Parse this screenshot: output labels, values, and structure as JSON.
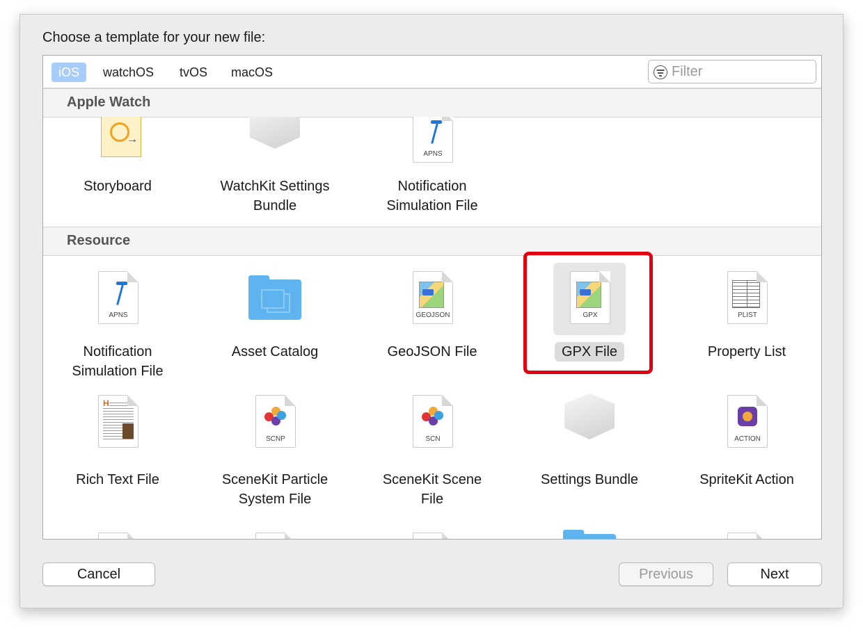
{
  "dialog": {
    "title": "Choose a template for your new file:"
  },
  "platform_tabs": [
    {
      "label": "iOS",
      "active": true
    },
    {
      "label": "watchOS",
      "active": false
    },
    {
      "label": "tvOS",
      "active": false
    },
    {
      "label": "macOS",
      "active": false
    }
  ],
  "filter": {
    "placeholder": "Filter",
    "icon": "filter-icon"
  },
  "sections": [
    {
      "title": "Apple Watch",
      "items": [
        {
          "label": "Storyboard",
          "icon": "storyboard-icon"
        },
        {
          "label": "WatchKit Settings Bundle",
          "icon": "settings-bundle-icon"
        },
        {
          "label": "Notification Simulation File",
          "icon": "apns-file-icon",
          "ext": "APNS"
        }
      ]
    },
    {
      "title": "Resource",
      "items": [
        {
          "label": "Notification Simulation File",
          "icon": "apns-file-icon",
          "ext": "APNS"
        },
        {
          "label": "Asset Catalog",
          "icon": "asset-catalog-folder-icon"
        },
        {
          "label": "GeoJSON File",
          "icon": "geojson-file-icon",
          "ext": "GEOJSON"
        },
        {
          "label": "GPX File",
          "icon": "gpx-file-icon",
          "ext": "GPX",
          "selected": true
        },
        {
          "label": "Property List",
          "icon": "plist-file-icon",
          "ext": "PLIST"
        },
        {
          "label": "Rich Text File",
          "icon": "rtf-file-icon"
        },
        {
          "label": "SceneKit Particle System File",
          "icon": "scnp-file-icon",
          "ext": "SCNP"
        },
        {
          "label": "SceneKit Scene File",
          "icon": "scn-file-icon",
          "ext": "SCN"
        },
        {
          "label": "Settings Bundle",
          "icon": "settings-bundle-icon"
        },
        {
          "label": "SpriteKit Action",
          "icon": "action-file-icon",
          "ext": "ACTION"
        }
      ]
    }
  ],
  "buttons": {
    "cancel": "Cancel",
    "previous": "Previous",
    "next": "Next"
  },
  "colors": {
    "tab_active": "#a9cdfb",
    "highlight": "#e0000f",
    "folder": "#5fb4ef"
  }
}
